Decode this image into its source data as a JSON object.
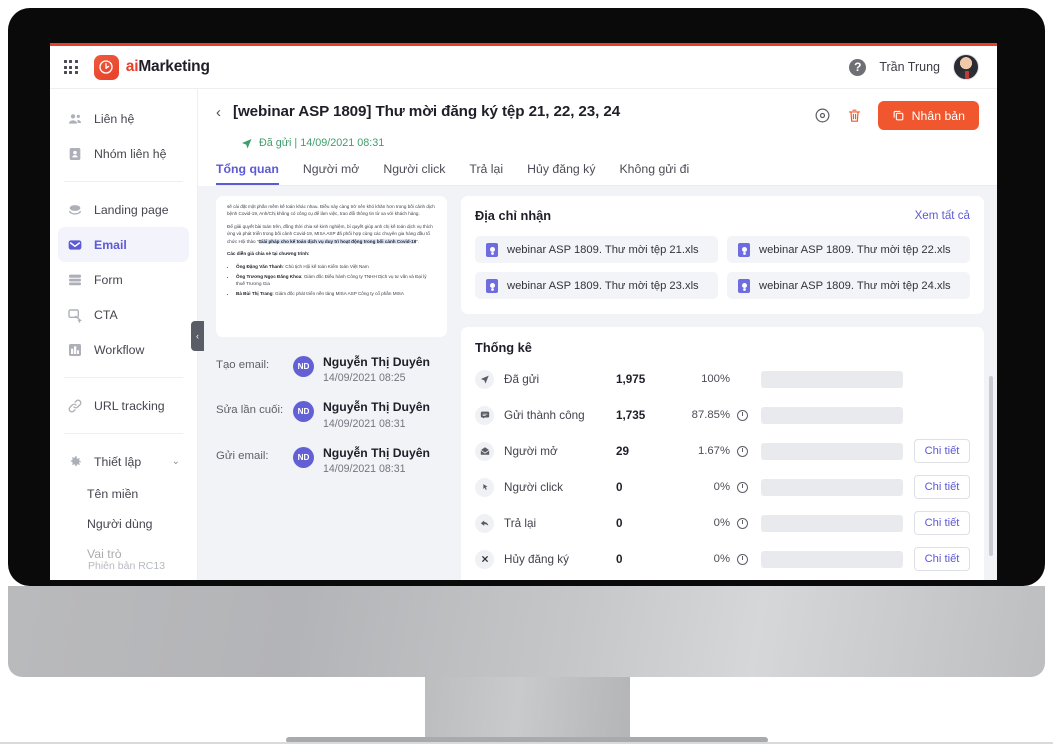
{
  "topbar": {
    "apps_icon": "grid-apps-icon",
    "brand_ai": "ai",
    "brand_rest": "Marketing",
    "help_icon": "help-icon",
    "user_name": "Trần Trung",
    "avatar": "user-avatar"
  },
  "sidebar": {
    "items": [
      {
        "label": "Liên hệ",
        "icon": "contacts-icon",
        "active": false
      },
      {
        "label": "Nhóm liên hệ",
        "icon": "contact-group-icon",
        "active": false
      },
      {
        "label": "Landing page",
        "icon": "landing-page-icon",
        "active": false
      },
      {
        "label": "Email",
        "icon": "email-icon",
        "active": true
      },
      {
        "label": "Form",
        "icon": "form-icon",
        "active": false
      },
      {
        "label": "CTA",
        "icon": "cta-icon",
        "active": false
      },
      {
        "label": "Workflow",
        "icon": "workflow-icon",
        "active": false
      },
      {
        "label": "URL tracking",
        "icon": "link-icon",
        "active": false
      },
      {
        "label": "Thiết lập",
        "icon": "gear-icon",
        "active": false
      }
    ],
    "sub_items": [
      {
        "label": "Tên miền"
      },
      {
        "label": "Người dùng"
      },
      {
        "label": "Vai trò"
      }
    ],
    "version": "Phiên bản RC13",
    "collapse_icon": "chevron-left-icon"
  },
  "header": {
    "back_icon": "chevron-left-icon",
    "title": "[webinar ASP 1809] Thư mời đăng ký tệp 21, 22, 23, 24",
    "status_icon": "sent-paper-plane-icon",
    "status_text": "Đã gửi | 14/09/2021 08:31",
    "preview_icon": "eye-icon",
    "delete_icon": "trash-icon",
    "duplicate_label": "Nhân bản",
    "duplicate_icon": "copy-icon"
  },
  "tabs": [
    {
      "label": "Tổng quan",
      "active": true
    },
    {
      "label": "Người mở",
      "active": false
    },
    {
      "label": "Người click",
      "active": false
    },
    {
      "label": "Trả lại",
      "active": false
    },
    {
      "label": "Hủy đăng ký",
      "active": false
    },
    {
      "label": "Không gửi đi",
      "active": false
    }
  ],
  "preview": {
    "p1": "sẽ cài đặt một phần mềm kế toán khác nhau. Điều này càng trở nên khó khăn hơn trong bối cảnh dịch bệnh Covid-19, Anh/Chị không có công cụ để làm việc, trao đổi thông tin từ xa với khách hàng.",
    "p2_a": "Để giải quyết bài toán trên, đồng thời chia sẻ kinh nghiệm, bí quyết giúp anh chị kế toán dịch vụ thích ứng và phát triển trong bối cảnh Covid-19, MISA ASP đã phối hợp cùng các chuyên gia hàng đầu tổ chức Hội thảo \"",
    "p2_b": "Giải pháp cho kế toán dịch vụ duy trì hoạt động trong bối cảnh Covid-19",
    "p2_c": "\".",
    "p3": "Các diễn giả chia sẻ tại chương trình:",
    "bullets": [
      {
        "name": "Ông Đặng Văn Thanh",
        "desc": ": Chủ tịch Hội kế toán Kiểm toán Việt Nam"
      },
      {
        "name": "Ông Trương Ngọc Đăng Khoa",
        "desc": ": Giám đốc Điều hành Công ty TNHH Dịch vụ tư vấn và Đại lý thuế Trương Gia"
      },
      {
        "name": "Bà Bùi Thị Trang",
        "desc": ": Giám đốc phát triển nền tảng MISA ASP Công ty cổ phần MISA"
      }
    ]
  },
  "meta": [
    {
      "label": "Tạo email:",
      "initials": "ND",
      "name": "Nguyễn Thị Duyên",
      "time": "14/09/2021 08:25"
    },
    {
      "label": "Sửa lần cuối:",
      "initials": "ND",
      "name": "Nguyễn Thị Duyên",
      "time": "14/09/2021 08:31"
    },
    {
      "label": "Gửi email:",
      "initials": "ND",
      "name": "Nguyễn Thị Duyên",
      "time": "14/09/2021 08:31"
    }
  ],
  "recipients": {
    "title": "Địa chỉ nhận",
    "view_all": "Xem tất cả",
    "files": [
      "webinar ASP 1809. Thư mời tệp 21.xls",
      "webinar ASP 1809. Thư mời tệp 22.xls",
      "webinar ASP 1809. Thư mời tệp 23.xls",
      "webinar ASP 1809. Thư mời tệp 24.xls"
    ]
  },
  "stats": {
    "title": "Thống kê",
    "detail_label": "Chi tiết",
    "rows": [
      {
        "icon": "sent-paper-plane-icon",
        "label": "Đã gửi",
        "value": "1,975",
        "percent": "100%",
        "bar": 100,
        "has_info": false,
        "has_detail": false
      },
      {
        "icon": "delivered-chat-icon",
        "label": "Gửi thành công",
        "value": "1,735",
        "percent": "87.85%",
        "bar": 87.85,
        "has_info": true,
        "has_detail": false
      },
      {
        "icon": "open-envelope-icon",
        "label": "Người mở",
        "value": "29",
        "percent": "1.67%",
        "bar": 1.67,
        "has_info": true,
        "has_detail": true
      },
      {
        "icon": "click-cursor-icon",
        "label": "Người click",
        "value": "0",
        "percent": "0%",
        "bar": 0,
        "has_info": true,
        "has_detail": true
      },
      {
        "icon": "reply-arrow-icon",
        "label": "Trả lại",
        "value": "0",
        "percent": "0%",
        "bar": 0,
        "has_info": true,
        "has_detail": true
      },
      {
        "icon": "close-x-icon",
        "label": "Hủy đăng ký",
        "value": "0",
        "percent": "0%",
        "bar": 0,
        "has_info": true,
        "has_detail": true
      }
    ]
  },
  "colors": {
    "brand_orange": "#e8402a",
    "button_orange": "#f1572e",
    "accent_purple": "#5d5ad6",
    "bar_purple": "#6360da",
    "status_green": "#3f9e6d",
    "content_bg": "#f1f3f7"
  }
}
